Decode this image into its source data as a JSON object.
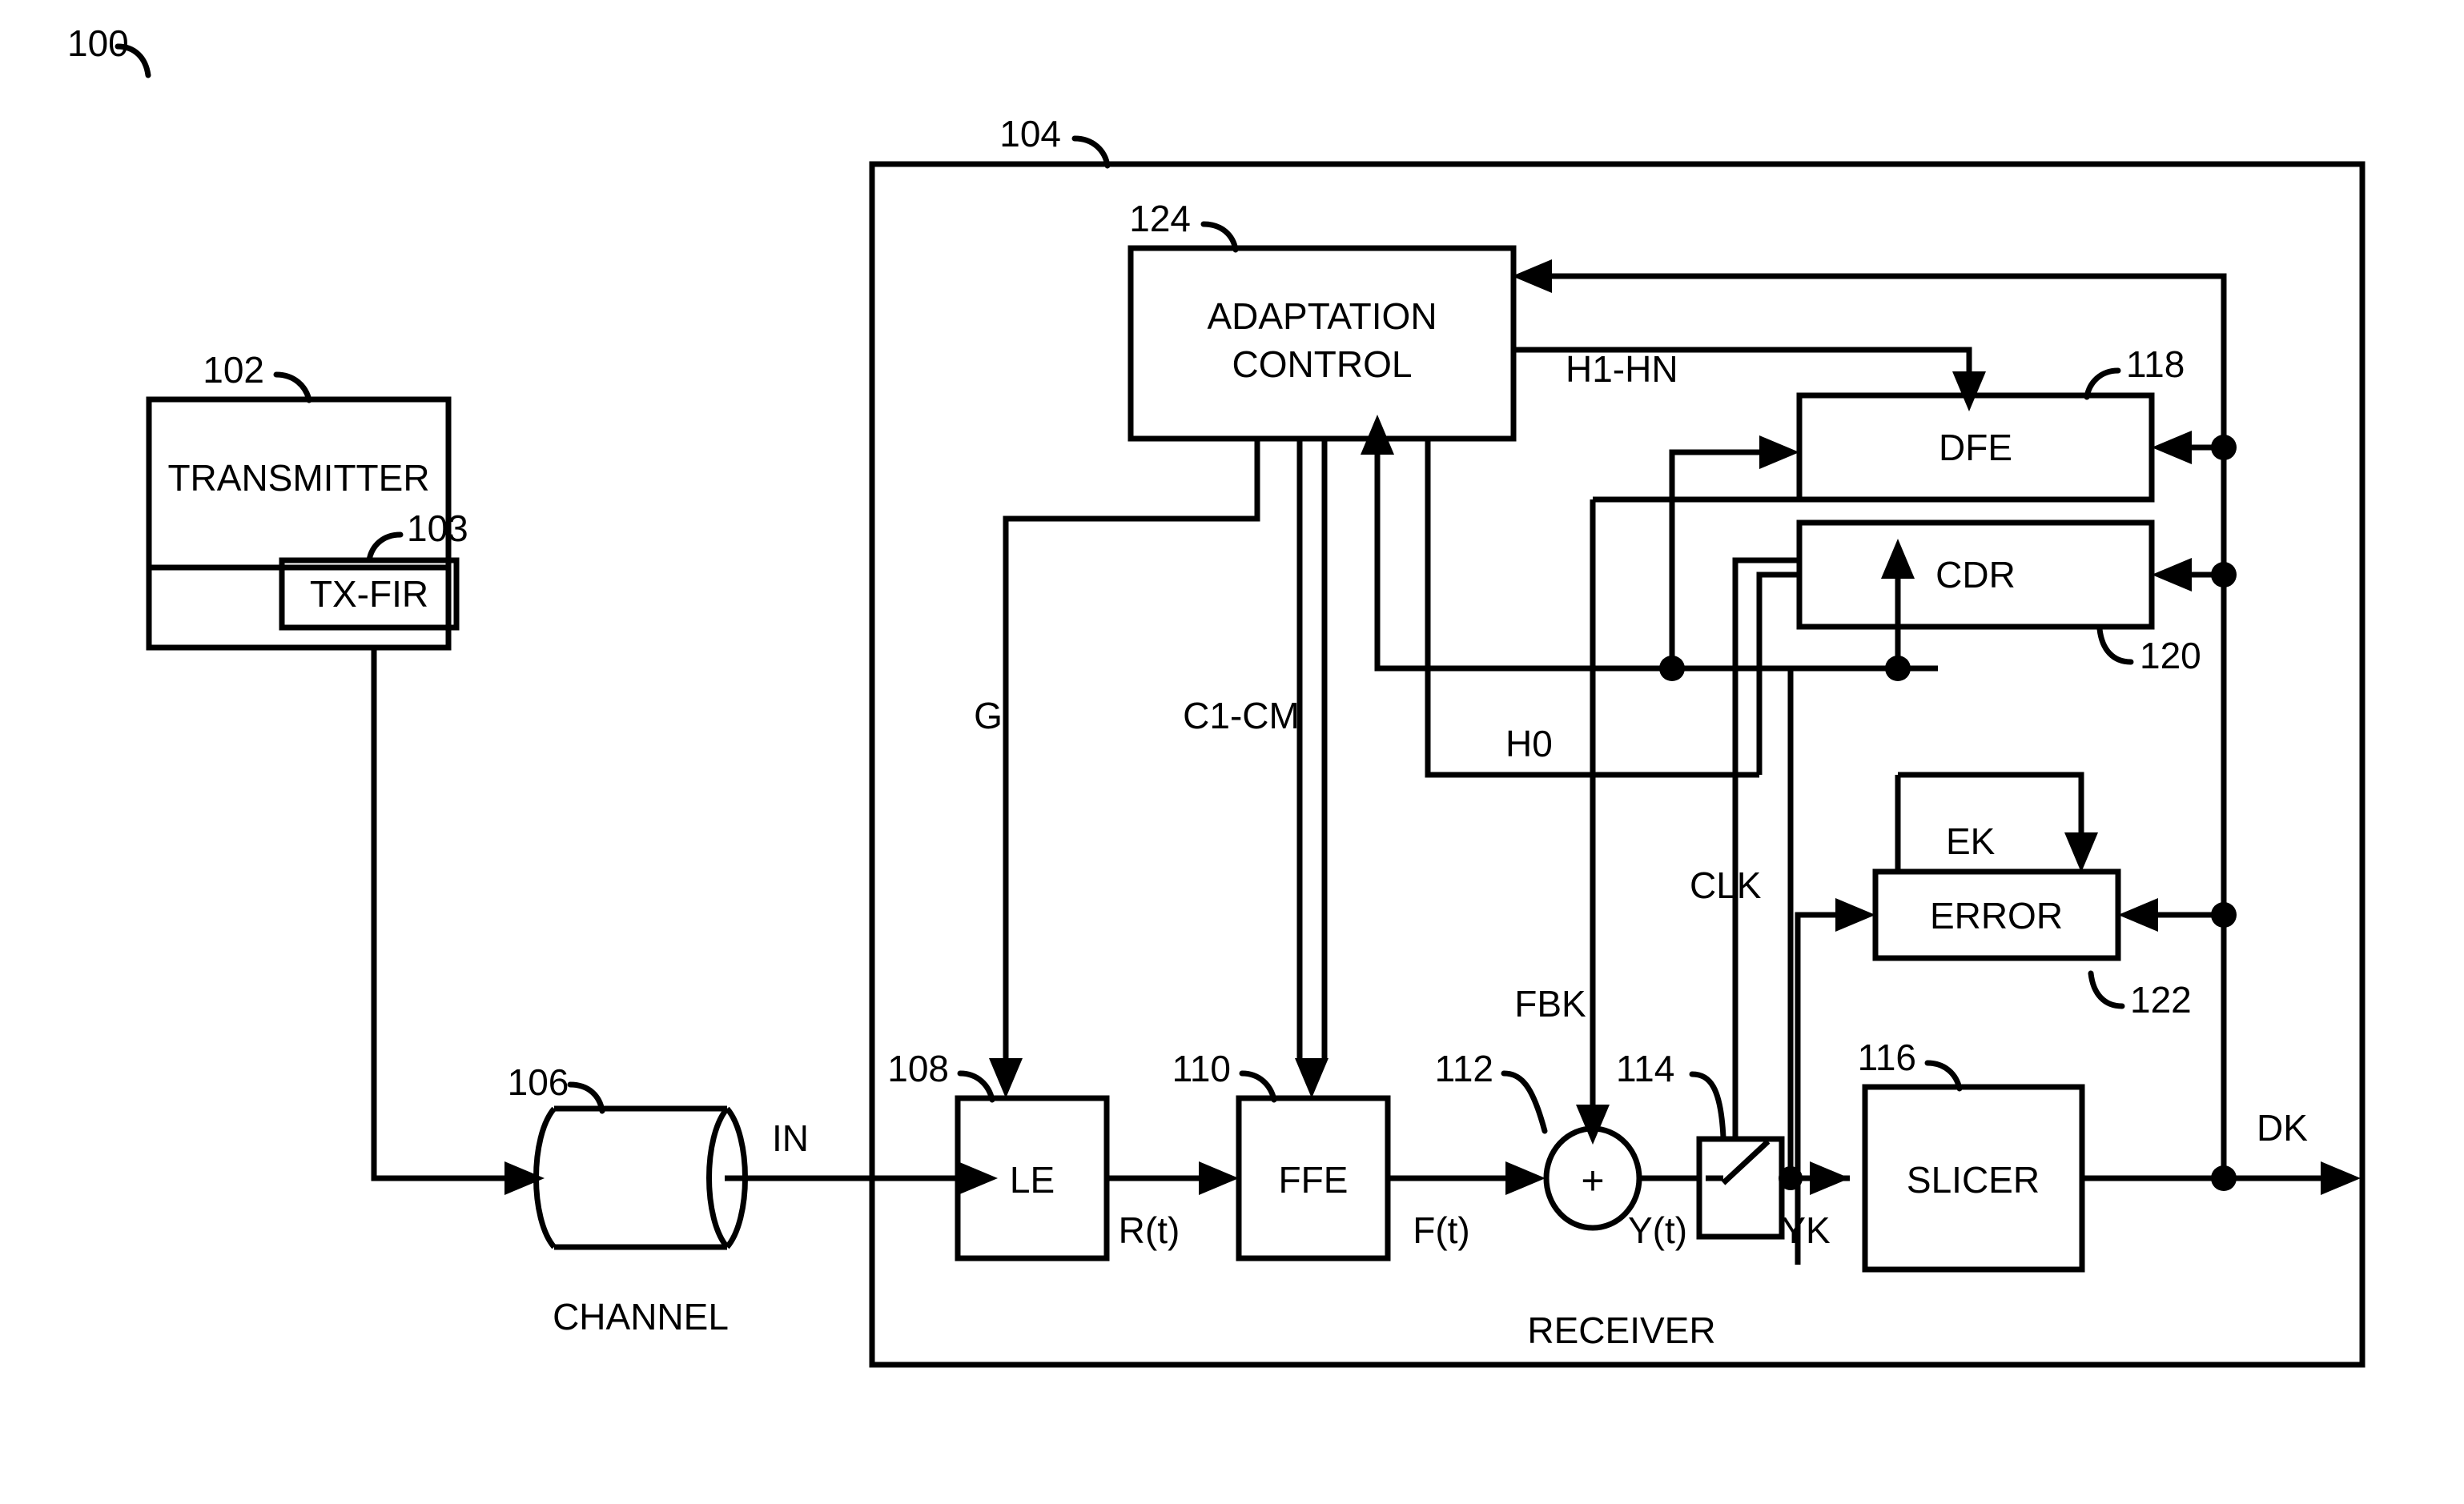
{
  "figure": {
    "id": "100",
    "system_label": "100"
  },
  "blocks": {
    "transmitter": {
      "label": "TRANSMITTER",
      "ref": "102"
    },
    "tx_fir": {
      "label": "TX-FIR",
      "ref": "103"
    },
    "receiver": {
      "label": "RECEIVER",
      "ref": "104"
    },
    "channel": {
      "label": "CHANNEL",
      "ref": "106"
    },
    "le": {
      "label": "LE",
      "ref": "108"
    },
    "ffe": {
      "label": "FFE",
      "ref": "110"
    },
    "summer": {
      "label": "+",
      "ref": "112"
    },
    "switch": {
      "label": "",
      "ref": "114"
    },
    "slicer": {
      "label": "SLICER",
      "ref": "116"
    },
    "dfe": {
      "label": "DFE",
      "ref": "118"
    },
    "cdr": {
      "label": "CDR",
      "ref": "120"
    },
    "error": {
      "label": "ERROR",
      "ref": "122"
    },
    "adaptation_control": {
      "label_line1": "ADAPTATION",
      "label_line2": "CONTROL",
      "ref": "124"
    }
  },
  "signals": {
    "in": "IN",
    "rt": "R(t)",
    "ft": "F(t)",
    "yt": "Y(t)",
    "yk": "YK",
    "dk": "DK",
    "g": "G",
    "c1_cm": "C1-CM",
    "h0": "H0",
    "h1_hn": "H1-HN",
    "clk": "CLK",
    "fbk": "FBK",
    "ek": "EK"
  }
}
